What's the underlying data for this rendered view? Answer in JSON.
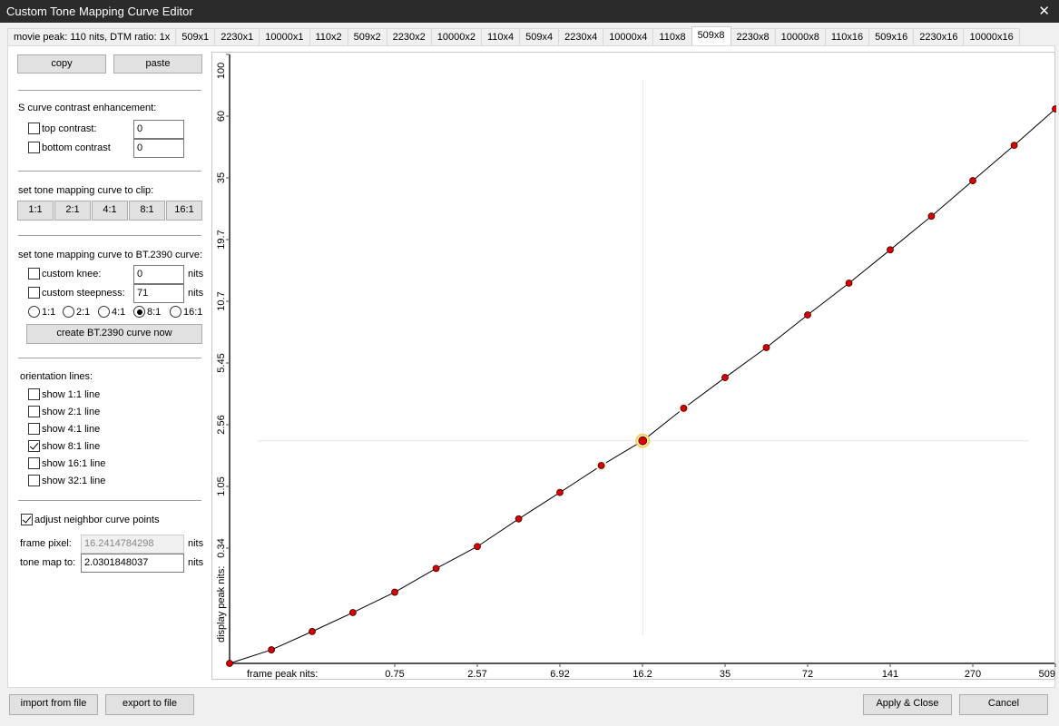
{
  "window": {
    "title": "Custom Tone Mapping Curve Editor",
    "close_icon": "close-icon"
  },
  "tabs": [
    "movie peak: 110 nits, DTM ratio: 1x",
    "509x1",
    "2230x1",
    "10000x1",
    "110x2",
    "509x2",
    "2230x2",
    "10000x2",
    "110x4",
    "509x4",
    "2230x4",
    "10000x4",
    "110x8",
    "509x8",
    "2230x8",
    "10000x8",
    "110x16",
    "509x16",
    "2230x16",
    "10000x16"
  ],
  "selected_tab": "509x8",
  "left": {
    "copy": "copy",
    "paste": "paste",
    "scurve": {
      "title": "S curve contrast enhancement:",
      "top_label": "top contrast:",
      "top_checked": false,
      "top_value": "0",
      "bottom_label": "bottom contrast",
      "bottom_checked": false,
      "bottom_value": "0"
    },
    "clip": {
      "title": "set tone mapping curve to clip:",
      "buttons": [
        "1:1",
        "2:1",
        "4:1",
        "8:1",
        "16:1"
      ]
    },
    "bt2390": {
      "title": "set tone mapping curve to BT.2390 curve:",
      "knee_label": "custom knee:",
      "knee_checked": false,
      "knee_value": "0",
      "steep_label": "custom steepness:",
      "steep_checked": false,
      "steep_value": "71",
      "unit": "nits",
      "ratios": [
        "1:1",
        "2:1",
        "4:1",
        "8:1",
        "16:1"
      ],
      "selected_ratio": "8:1",
      "create": "create BT.2390 curve now"
    },
    "orientation": {
      "title": "orientation lines:",
      "items": [
        {
          "label": "show 1:1 line",
          "checked": false
        },
        {
          "label": "show 2:1 line",
          "checked": false
        },
        {
          "label": "show 4:1 line",
          "checked": false
        },
        {
          "label": "show 8:1 line",
          "checked": true
        },
        {
          "label": "show 16:1 line",
          "checked": false
        },
        {
          "label": "show 32:1 line",
          "checked": false
        }
      ]
    },
    "adjust": {
      "label": "adjust neighbor curve points",
      "checked": true
    },
    "frame_pixel": {
      "label": "frame pixel:",
      "value": "16.2414784298",
      "unit": "nits"
    },
    "tone_map": {
      "label": "tone map to:",
      "value": "2.0301848037",
      "unit": "nits"
    }
  },
  "bottom": {
    "import": "import from file",
    "export": "export to file",
    "apply": "Apply & Close",
    "cancel": "Cancel"
  },
  "chart_data": {
    "type": "line",
    "xlabel": "frame peak nits:",
    "ylabel": "display peak nits:",
    "x_ticks": [
      "0.75",
      "2.57",
      "6.92",
      "16.2",
      "35",
      "72",
      "141",
      "270",
      "509"
    ],
    "y_ticks": [
      "0.34",
      "1.05",
      "2.56",
      "5.45",
      "10.7",
      "19.7",
      "35",
      "60",
      "100"
    ],
    "points": [
      [
        0,
        0
      ],
      [
        0.19,
        0.04
      ],
      [
        0.375,
        0.094
      ],
      [
        0.56,
        0.15
      ],
      [
        0.75,
        0.21
      ],
      [
        1.39,
        0.28
      ],
      [
        2.57,
        0.35
      ],
      [
        4.22,
        0.58
      ],
      [
        6.92,
        0.94
      ],
      [
        10.6,
        1.42
      ],
      [
        16.24,
        2.03
      ],
      [
        23.8,
        3.13
      ],
      [
        35,
        4.56
      ],
      [
        50.2,
        6.45
      ],
      [
        72,
        9.22
      ],
      [
        100.8,
        12.8
      ],
      [
        141,
        17.8
      ],
      [
        195,
        24.5
      ],
      [
        270,
        34.1
      ],
      [
        371,
        46.5
      ],
      [
        509,
        63.7
      ]
    ],
    "selected_point": [
      16.24,
      2.03
    ],
    "colors": {
      "point": "#d40000",
      "selected_ring": "#f0d060",
      "curve": "#000000",
      "crosshair": "#e6e6e6"
    }
  }
}
